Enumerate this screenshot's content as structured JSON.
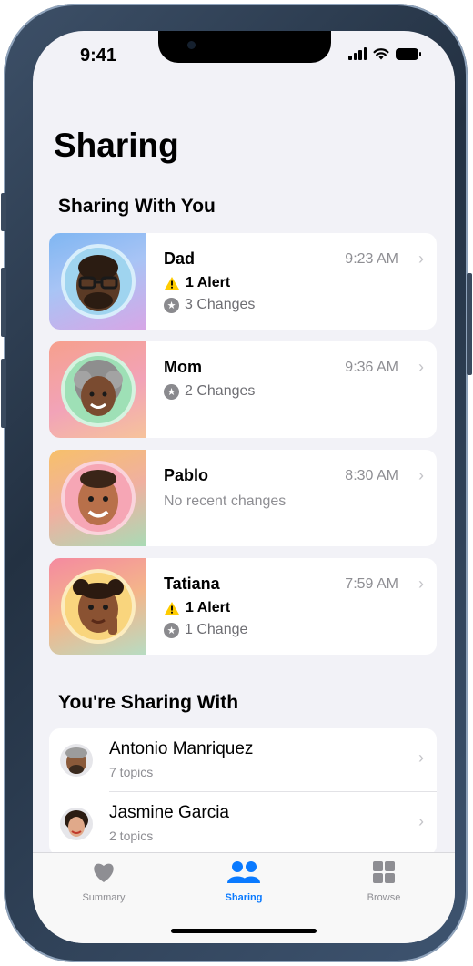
{
  "status_bar": {
    "time": "9:41"
  },
  "page": {
    "title": "Sharing"
  },
  "sharing_with_you": {
    "header": "Sharing With You",
    "people": [
      {
        "name": "Dad",
        "time": "9:23 AM",
        "alert": "1 Alert",
        "changes": "3 Changes"
      },
      {
        "name": "Mom",
        "time": "9:36 AM",
        "changes": "2 Changes"
      },
      {
        "name": "Pablo",
        "time": "8:30 AM",
        "status": "No recent changes"
      },
      {
        "name": "Tatiana",
        "time": "7:59 AM",
        "alert": "1 Alert",
        "changes": "1 Change"
      }
    ]
  },
  "youre_sharing_with": {
    "header": "You're Sharing With",
    "people": [
      {
        "name": "Antonio Manriquez",
        "topics": "7 topics"
      },
      {
        "name": "Jasmine Garcia",
        "topics": "2 topics"
      }
    ]
  },
  "tab_bar": {
    "tabs": [
      {
        "label": "Summary",
        "icon": "heart-icon"
      },
      {
        "label": "Sharing",
        "icon": "people-icon",
        "active": true
      },
      {
        "label": "Browse",
        "icon": "grid-icon"
      }
    ]
  },
  "colors": {
    "accent": "#0a7aff",
    "alert": "#ffcc00",
    "background": "#f2f2f7"
  }
}
